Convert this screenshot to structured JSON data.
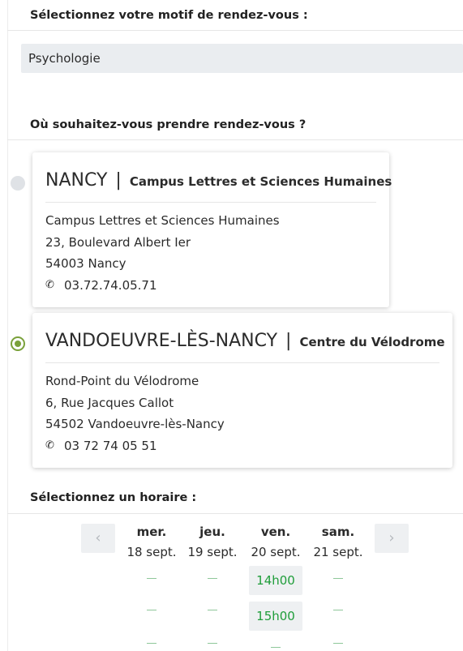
{
  "motif": {
    "title": "Sélectionnez votre motif de rendez-vous :",
    "selected": "Psychologie"
  },
  "location": {
    "title": "Où souhaitez-vous prendre rendez-vous ?",
    "options": [
      {
        "city": "NANCY",
        "separator": "|",
        "campus": "Campus Lettres et Sciences Humaines",
        "address_lines": [
          "Campus Lettres et Sciences Humaines",
          "23, Boulevard Albert Ier",
          "54003 Nancy"
        ],
        "phone": "03.72.74.05.71",
        "selected": false
      },
      {
        "city": "VANDOEUVRE-LÈS-NANCY",
        "separator": "|",
        "campus": "Centre du Vélodrome",
        "address_lines": [
          "Rond-Point du Vélodrome",
          "6, Rue Jacques Callot",
          "54502 Vandoeuvre-lès-Nancy"
        ],
        "phone": "03 72 74 05 51",
        "selected": true
      }
    ]
  },
  "schedule": {
    "title": "Sélectionnez un horaire :",
    "prev_label": "‹",
    "next_label": "›",
    "days": [
      {
        "name": "mer.",
        "date": "18 sept."
      },
      {
        "name": "jeu.",
        "date": "19 sept."
      },
      {
        "name": "ven.",
        "date": "20 sept."
      },
      {
        "name": "sam.",
        "date": "21 sept."
      }
    ],
    "slots": [
      "14h00",
      "15h00"
    ]
  },
  "colors": {
    "accent_green": "#7aa13b",
    "slot_text": "#1f9d3a",
    "select_bg": "#eaedf0"
  },
  "icons": {
    "phone": "phone-icon",
    "prev": "chevron-left-icon",
    "next": "chevron-right-icon"
  }
}
